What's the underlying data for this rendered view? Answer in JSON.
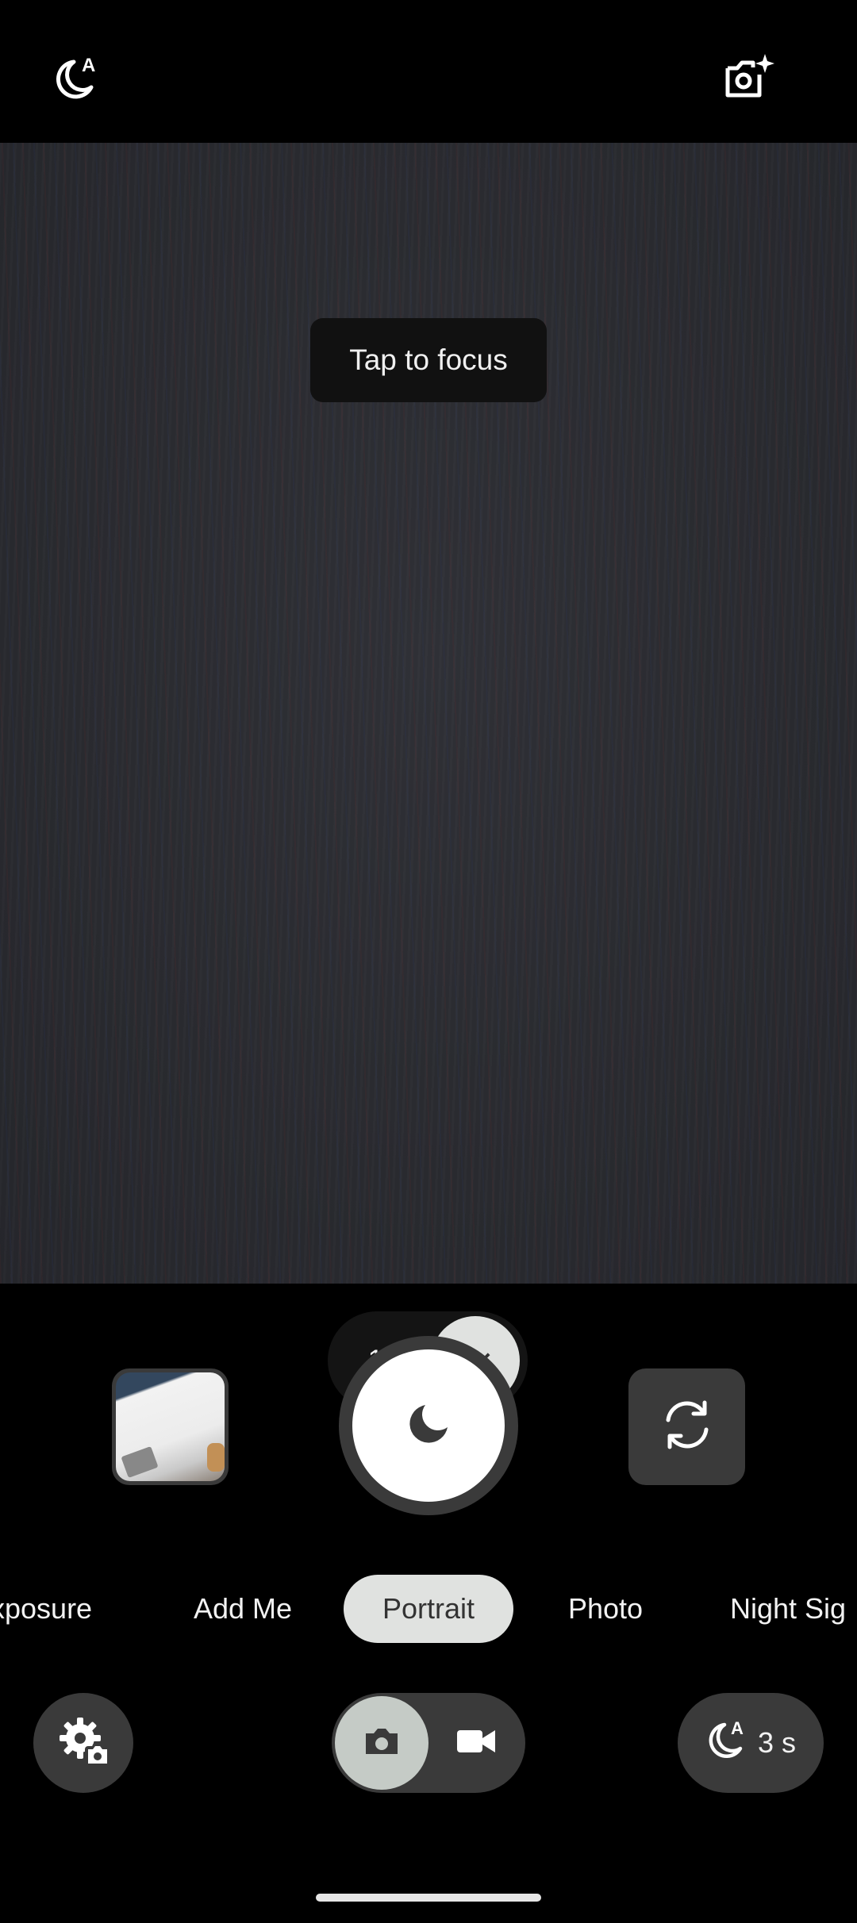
{
  "top_bar": {
    "night_auto_icon": "night-auto-icon",
    "camera_sparkle_icon": "camera-sparkle-icon"
  },
  "viewfinder": {
    "focus_hint": "Tap to focus",
    "zoom": {
      "option_1": "1.5",
      "option_2": "2×",
      "selected": "2×"
    }
  },
  "controls": {
    "thumbnail_label": "last-photo-thumbnail",
    "shutter_icon": "moon-icon",
    "flip_icon": "flip-camera-icon"
  },
  "modes": {
    "items": [
      {
        "label": "xposure"
      },
      {
        "label": "Add Me"
      },
      {
        "label": "Portrait"
      },
      {
        "label": "Photo"
      },
      {
        "label": "Night Sig"
      }
    ],
    "selected": "Portrait"
  },
  "bottom": {
    "settings_icon": "settings-gear-icon",
    "toggle_photo_icon": "camera-icon",
    "toggle_video_icon": "video-icon",
    "night_timer_label": "3 s"
  },
  "colors": {
    "background": "#000000",
    "button_gray": "#3a3a3a",
    "selected_pill": "#e0e2e0",
    "toggle_selected": "#c5cbc6"
  }
}
